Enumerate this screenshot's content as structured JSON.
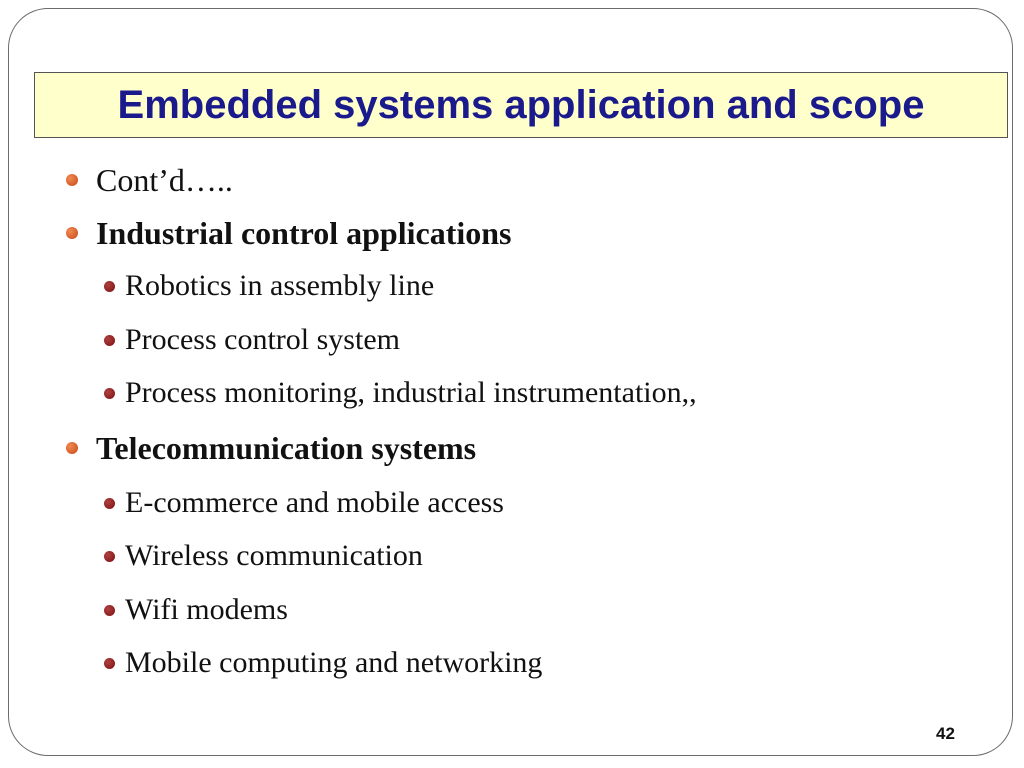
{
  "slide": {
    "title": "Embedded systems application and scope",
    "bullets": [
      {
        "text": "Cont’d…..",
        "level": 1,
        "bold": false
      },
      {
        "text": "Industrial control applications",
        "level": 1,
        "bold": true
      },
      {
        "text": "Robotics in assembly line",
        "level": 2,
        "bold": false
      },
      {
        "text": "Process control system",
        "level": 2,
        "bold": false
      },
      {
        "text": "Process monitoring, industrial instrumentation,,",
        "level": 2,
        "bold": false
      },
      {
        "text": "Telecommunication systems",
        "level": 1,
        "bold": true
      },
      {
        "text": "E-commerce and mobile access",
        "level": 2,
        "bold": false
      },
      {
        "text": "Wireless communication",
        "level": 2,
        "bold": false
      },
      {
        "text": "Wifi modems",
        "level": 2,
        "bold": false
      },
      {
        "text": "Mobile computing and networking",
        "level": 2,
        "bold": false
      }
    ],
    "page_number": "42"
  },
  "colors": {
    "title_text": "#1a1a8c",
    "title_background": "#ffffcc",
    "level1_bullet": "#e06a30",
    "level2_bullet": "#8b1a1a"
  },
  "icons": {
    "level1_bullet": "bullet-dot-icon",
    "level2_bullet": "bullet-dot-icon"
  }
}
